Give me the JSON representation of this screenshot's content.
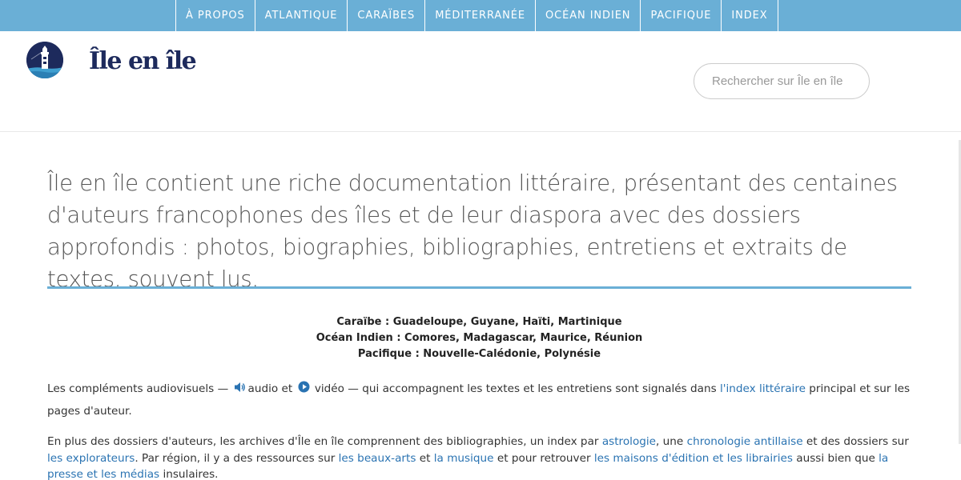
{
  "nav": {
    "items": [
      "À PROPOS",
      "ATLANTIQUE",
      "CARAÏBES",
      "MÉDITERRANÉE",
      "OCÉAN INDIEN",
      "PACIFIQUE",
      "INDEX"
    ]
  },
  "header": {
    "site_title": "Île en île",
    "search_placeholder": "Rechercher sur Île en île"
  },
  "main": {
    "lead": "Île en île contient une riche documentation littéraire, présentant des centaines d'auteurs francophones des îles et de leur diaspora avec des dossiers approfondis : photos, biographies, bibliographies, entretiens et extraits de textes, souvent lus.",
    "regions": [
      "Caraïbe : Guadeloupe, Guyane, Haïti, Martinique",
      "Océan Indien : Comores, Madagascar, Maurice, Réunion",
      "Pacifique : Nouvelle-Calédonie, Polynésie"
    ],
    "p1": {
      "t1": "Les compléments audiovisuels —",
      "audio": "audio et",
      "video": "vidéo — qui accompagnent les textes et les entretiens sont signalés dans",
      "link_index": "l'index littéraire",
      "t2": "principal et sur les pages d'auteur."
    },
    "p2": {
      "t1": "En plus des dossiers d'auteurs, les archives d'Île en île comprennent des bibliographies, un index par",
      "link_astrologie": "astrologie",
      "t2": ", une",
      "link_chronologie": "chronologie antillaise",
      "t3": "et des dossiers sur",
      "link_explorateurs": "les explorateurs",
      "t4": ". Par région, il y a des ressources sur",
      "link_beaux_arts": "les beaux-arts",
      "t5": "et",
      "link_musique": "la musique",
      "t6": "et pour retrouver",
      "link_maisons": "les maisons d'édition et les librairies",
      "t7": "aussi bien que",
      "link_presse": "la presse et les médias",
      "t8": "insulaires."
    }
  },
  "colors": {
    "nav_bg": "#6aafd6",
    "title": "#1d2a5c",
    "link": "#2a73b2",
    "rule": "#6aafd6"
  },
  "icons": [
    "lighthouse-logo-icon",
    "speaker-icon",
    "play-icon"
  ]
}
